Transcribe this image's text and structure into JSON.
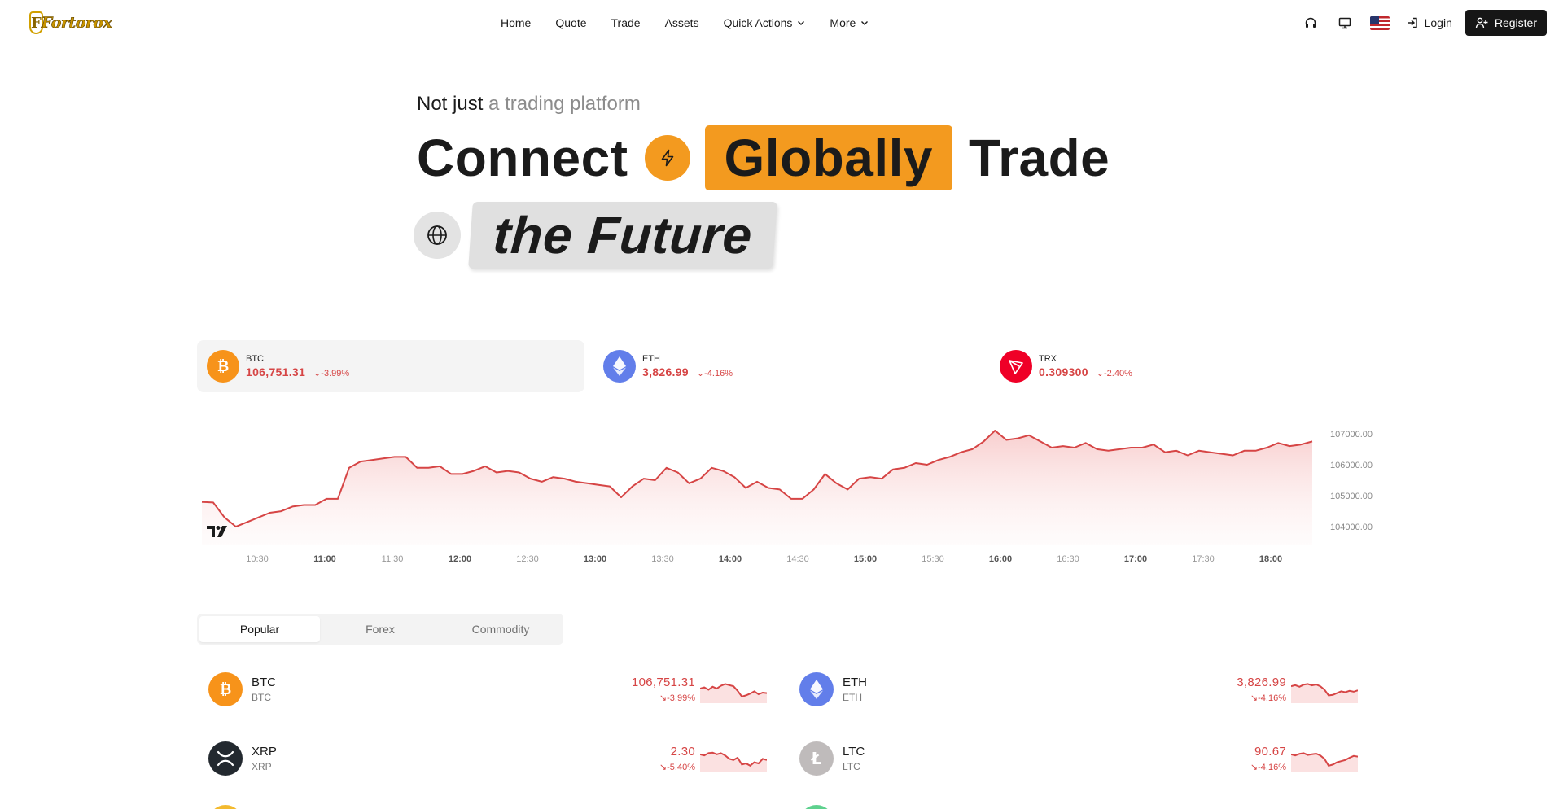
{
  "nav": {
    "logo_text": "Fortorox",
    "menu": [
      {
        "label": "Home"
      },
      {
        "label": "Quote"
      },
      {
        "label": "Trade"
      },
      {
        "label": "Assets"
      },
      {
        "label": "Quick Actions",
        "dropdown": true
      },
      {
        "label": "More",
        "dropdown": true
      }
    ],
    "icons": [
      "headset-icon",
      "desktop-icon",
      "us-flag-icon"
    ],
    "login_label": "Login",
    "register_label": "Register"
  },
  "hero": {
    "sub_prefix": "Not just",
    "sub_dim": "a trading platform",
    "word1": "Connect",
    "word2": "Globally",
    "word3": "Trade",
    "word4": "the Future",
    "accent_color": "#f39a1f"
  },
  "tickers": [
    {
      "symbol": "BTC",
      "price": "106,751.31",
      "change": "-3.99%",
      "active": true,
      "icon": "bitcoin-icon",
      "color": "#f7931a"
    },
    {
      "symbol": "ETH",
      "price": "3,826.99",
      "change": "-4.16%",
      "active": false,
      "icon": "ethereum-icon",
      "color": "#627eea"
    },
    {
      "symbol": "TRX",
      "price": "0.309300",
      "change": "-2.40%",
      "active": false,
      "icon": "tron-icon",
      "color": "#ef0027"
    }
  ],
  "chart_data": {
    "type": "area",
    "series": [
      {
        "values": [
          104800,
          104780,
          104300,
          104000,
          104150,
          104300,
          104450,
          104500,
          104650,
          104700,
          104700,
          104900,
          104900,
          105900,
          106100,
          106150,
          106200,
          106250,
          106250,
          105900,
          105900,
          105950,
          105700,
          105700,
          105800,
          105950,
          105750,
          105800,
          105750,
          105550,
          105450,
          105600,
          105550,
          105450,
          105400,
          105350,
          105300,
          104950,
          105300,
          105550,
          105500,
          105900,
          105750,
          105400,
          105550,
          105900,
          105800,
          105600,
          105250,
          105450,
          105250,
          105200,
          104900,
          104900,
          105200,
          105700,
          105400,
          105200,
          105550,
          105600,
          105550,
          105850,
          105900,
          106050,
          106000,
          106150,
          106250,
          106400,
          106500,
          106750,
          107100,
          106800,
          106850,
          106950,
          106750,
          106550,
          106600,
          106550,
          106700,
          106500,
          106450,
          106500,
          106550,
          106550,
          106650,
          106400,
          106450,
          106300,
          106450,
          106400,
          106350,
          106300,
          106450,
          106450,
          106550,
          106700,
          106600,
          106650,
          106750
        ]
      }
    ],
    "x_ticks": [
      "10:30",
      "11:00",
      "11:30",
      "12:00",
      "12:30",
      "13:00",
      "13:30",
      "14:00",
      "14:30",
      "15:00",
      "15:30",
      "16:00",
      "16:30",
      "17:00",
      "17:30",
      "18:00"
    ],
    "x_ticks_bold": [
      "11:00",
      "12:00",
      "13:00",
      "14:00",
      "15:00",
      "16:00",
      "17:00",
      "18:00"
    ],
    "y_ticks": [
      "107000.00",
      "106000.00",
      "105000.00",
      "104000.00"
    ],
    "ylim": [
      103400,
      107600
    ],
    "line_color": "#d64545",
    "fill_color": "#f9dada",
    "watermark": "TV"
  },
  "tabs": [
    {
      "label": "Popular",
      "active": true
    },
    {
      "label": "Forex",
      "active": false
    },
    {
      "label": "Commodity",
      "active": false
    }
  ],
  "market": [
    {
      "name": "BTC",
      "sub": "BTC",
      "price": "106,751.31",
      "change": "-3.99%",
      "icon": "bitcoin-icon",
      "color": "#f7931a",
      "spark": [
        0.5,
        0.45,
        0.55,
        0.42,
        0.5,
        0.38,
        0.3,
        0.35,
        0.4,
        0.6,
        0.85,
        0.8,
        0.72,
        0.62,
        0.75,
        0.68,
        0.7
      ]
    },
    {
      "name": "ETH",
      "sub": "ETH",
      "price": "3,826.99",
      "change": "-4.16%",
      "icon": "ethereum-icon",
      "color": "#627eea",
      "spark": [
        0.4,
        0.35,
        0.42,
        0.33,
        0.3,
        0.36,
        0.32,
        0.4,
        0.55,
        0.8,
        0.78,
        0.7,
        0.62,
        0.66,
        0.6,
        0.64,
        0.58
      ]
    },
    {
      "name": "XRP",
      "sub": "XRP",
      "price": "2.30",
      "change": "-5.40%",
      "icon": "xrp-icon",
      "color": "#23292f",
      "spark": [
        0.35,
        0.4,
        0.3,
        0.28,
        0.35,
        0.3,
        0.4,
        0.55,
        0.6,
        0.5,
        0.8,
        0.75,
        0.85,
        0.7,
        0.75,
        0.55,
        0.6
      ]
    },
    {
      "name": "LTC",
      "sub": "LTC",
      "price": "90.67",
      "change": "-4.16%",
      "icon": "litecoin-icon",
      "color": "#bfbbbb",
      "spark": [
        0.35,
        0.4,
        0.33,
        0.3,
        0.38,
        0.35,
        0.32,
        0.4,
        0.55,
        0.85,
        0.8,
        0.7,
        0.65,
        0.6,
        0.5,
        0.42,
        0.45
      ]
    }
  ]
}
